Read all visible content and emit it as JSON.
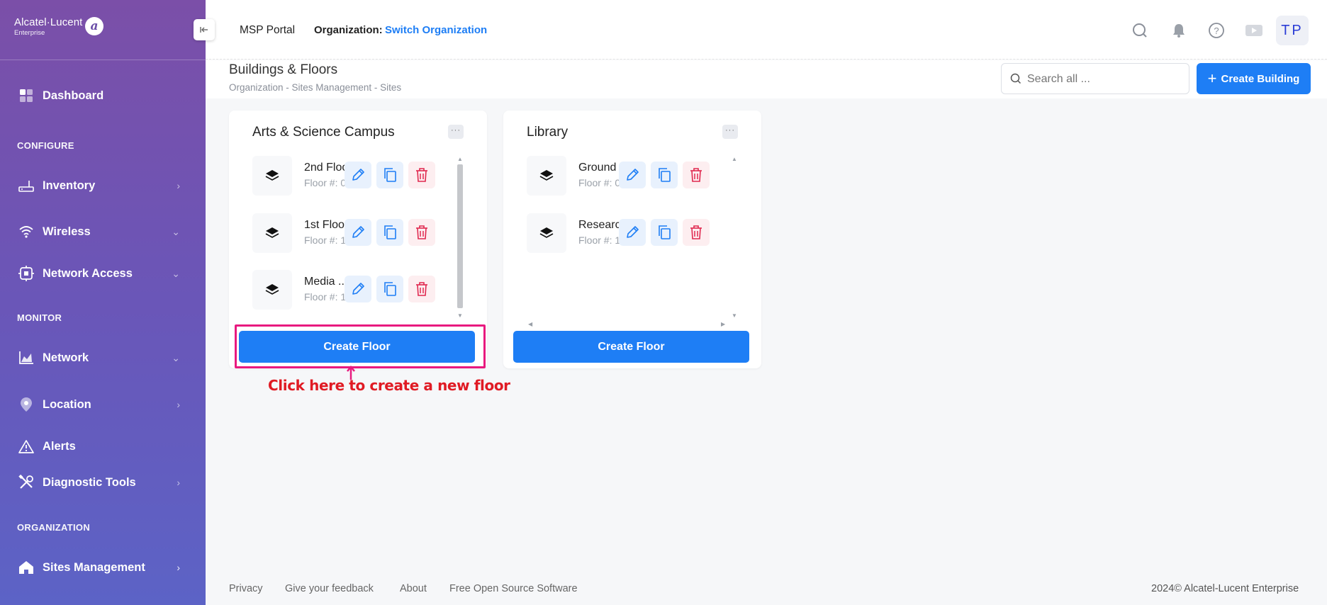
{
  "brand": {
    "name": "Alcatel·Lucent",
    "sub": "Enterprise"
  },
  "topbar": {
    "portal": "MSP Portal",
    "org_label": "Organization:",
    "org_link": "Switch Organization",
    "avatar": "TP",
    "icons": [
      "search-icon",
      "bell-icon",
      "help-icon",
      "video-icon"
    ]
  },
  "sidebar": {
    "dashboard": "Dashboard",
    "sections": {
      "configure": "CONFIGURE",
      "monitor": "MONITOR",
      "organization": "ORGANIZATION"
    },
    "items": {
      "inventory": "Inventory",
      "wireless": "Wireless",
      "network_access": "Network Access",
      "network": "Network",
      "location": "Location",
      "alerts": "Alerts",
      "diagnostic_tools": "Diagnostic Tools",
      "sites_management": "Sites Management"
    }
  },
  "page": {
    "title": "Buildings & Floors",
    "breadcrumb": "Organization  -  Sites Management  -  Sites",
    "search_placeholder": "Search all ...",
    "create_building": "Create Building"
  },
  "buildings": [
    {
      "name": "Arts & Science Campus",
      "more": "···",
      "floors": [
        {
          "name": "2nd Floor",
          "number": "Floor #: 0"
        },
        {
          "name": "1st Floor",
          "number": "Floor #: 1"
        },
        {
          "name": "Media ...",
          "number": "Floor #: 1"
        }
      ],
      "create_floor": "Create Floor"
    },
    {
      "name": "Library",
      "more": "···",
      "floors": [
        {
          "name": "Ground ...",
          "number": "Floor #: 0"
        },
        {
          "name": "Researc...",
          "number": "Floor #: 1"
        }
      ],
      "create_floor": "Create Floor"
    }
  ],
  "annotation": {
    "text": "Click here to create a new floor",
    "color": "#e01b24",
    "box_color": "#e8197f"
  },
  "footer": {
    "links": [
      "Privacy",
      "Give your feedback",
      "About",
      "Free Open Source Software"
    ],
    "copyright": "2024© Alcatel-Lucent Enterprise"
  },
  "colors": {
    "accent": "#1e7ef5",
    "delete": "#e0284f",
    "sidebar_top": "#7b4fa8",
    "sidebar_bottom": "#5c63c6"
  }
}
